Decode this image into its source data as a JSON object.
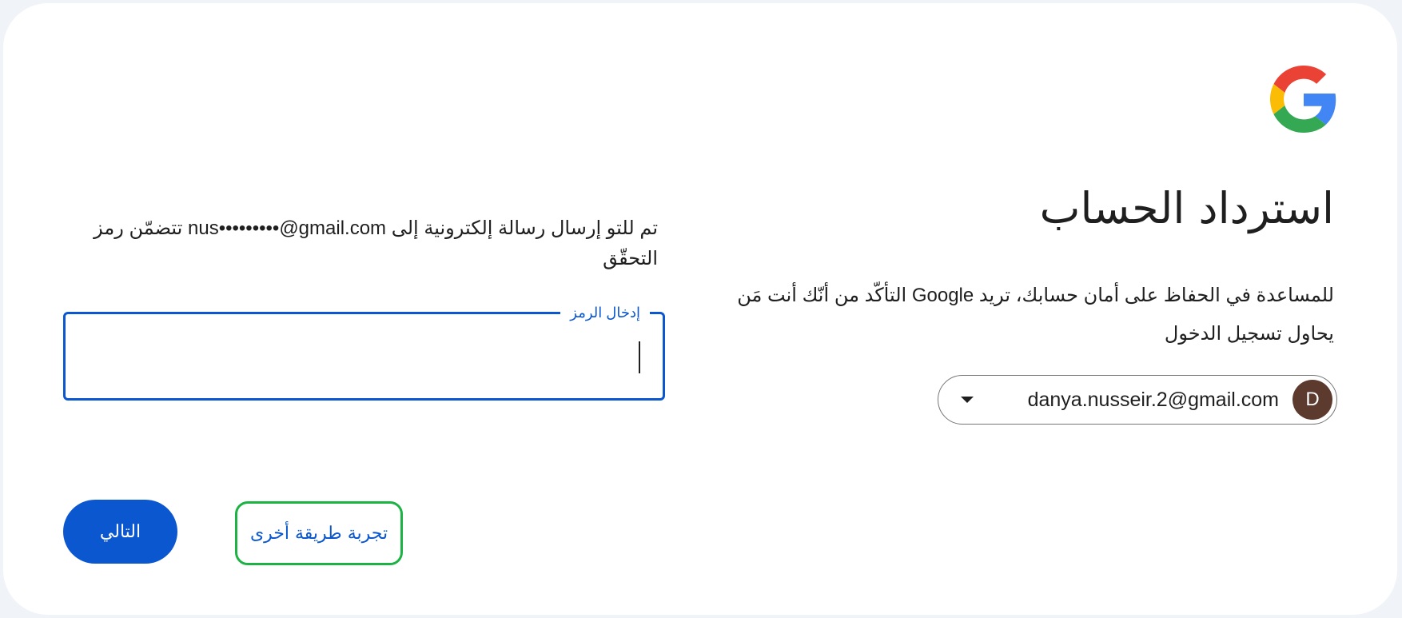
{
  "page": {
    "title": "استرداد الحساب",
    "description": "للمساعدة في الحفاظ على أمان حسابك، تريد Google التأكّد من أنّك أنت مَن يحاول تسجيل الدخول"
  },
  "logo": {
    "icon": "google-g-logo",
    "colors": {
      "red": "#ea4335",
      "yellow": "#fbbc05",
      "green": "#34a853",
      "blue": "#4285f4"
    }
  },
  "account": {
    "email": "danya.nusseir.2@gmail.com",
    "avatar_letter": "D",
    "avatar_color": "#5d3a2e",
    "dropdown_icon": "caret-down-icon"
  },
  "verification": {
    "instruction": "تم للتو إرسال رسالة إلكترونية إلى nus•••••••••@gmail.com تتضمّن رمز التحقّق",
    "code_label": "إدخال الرمز",
    "code_value": ""
  },
  "actions": {
    "try_another": "تجربة طريقة أخرى",
    "next": "التالي"
  },
  "colors": {
    "accent": "#0b57d0",
    "highlight_border": "#1db344",
    "text": "#1f1f1f",
    "background": "#f0f4f9"
  }
}
